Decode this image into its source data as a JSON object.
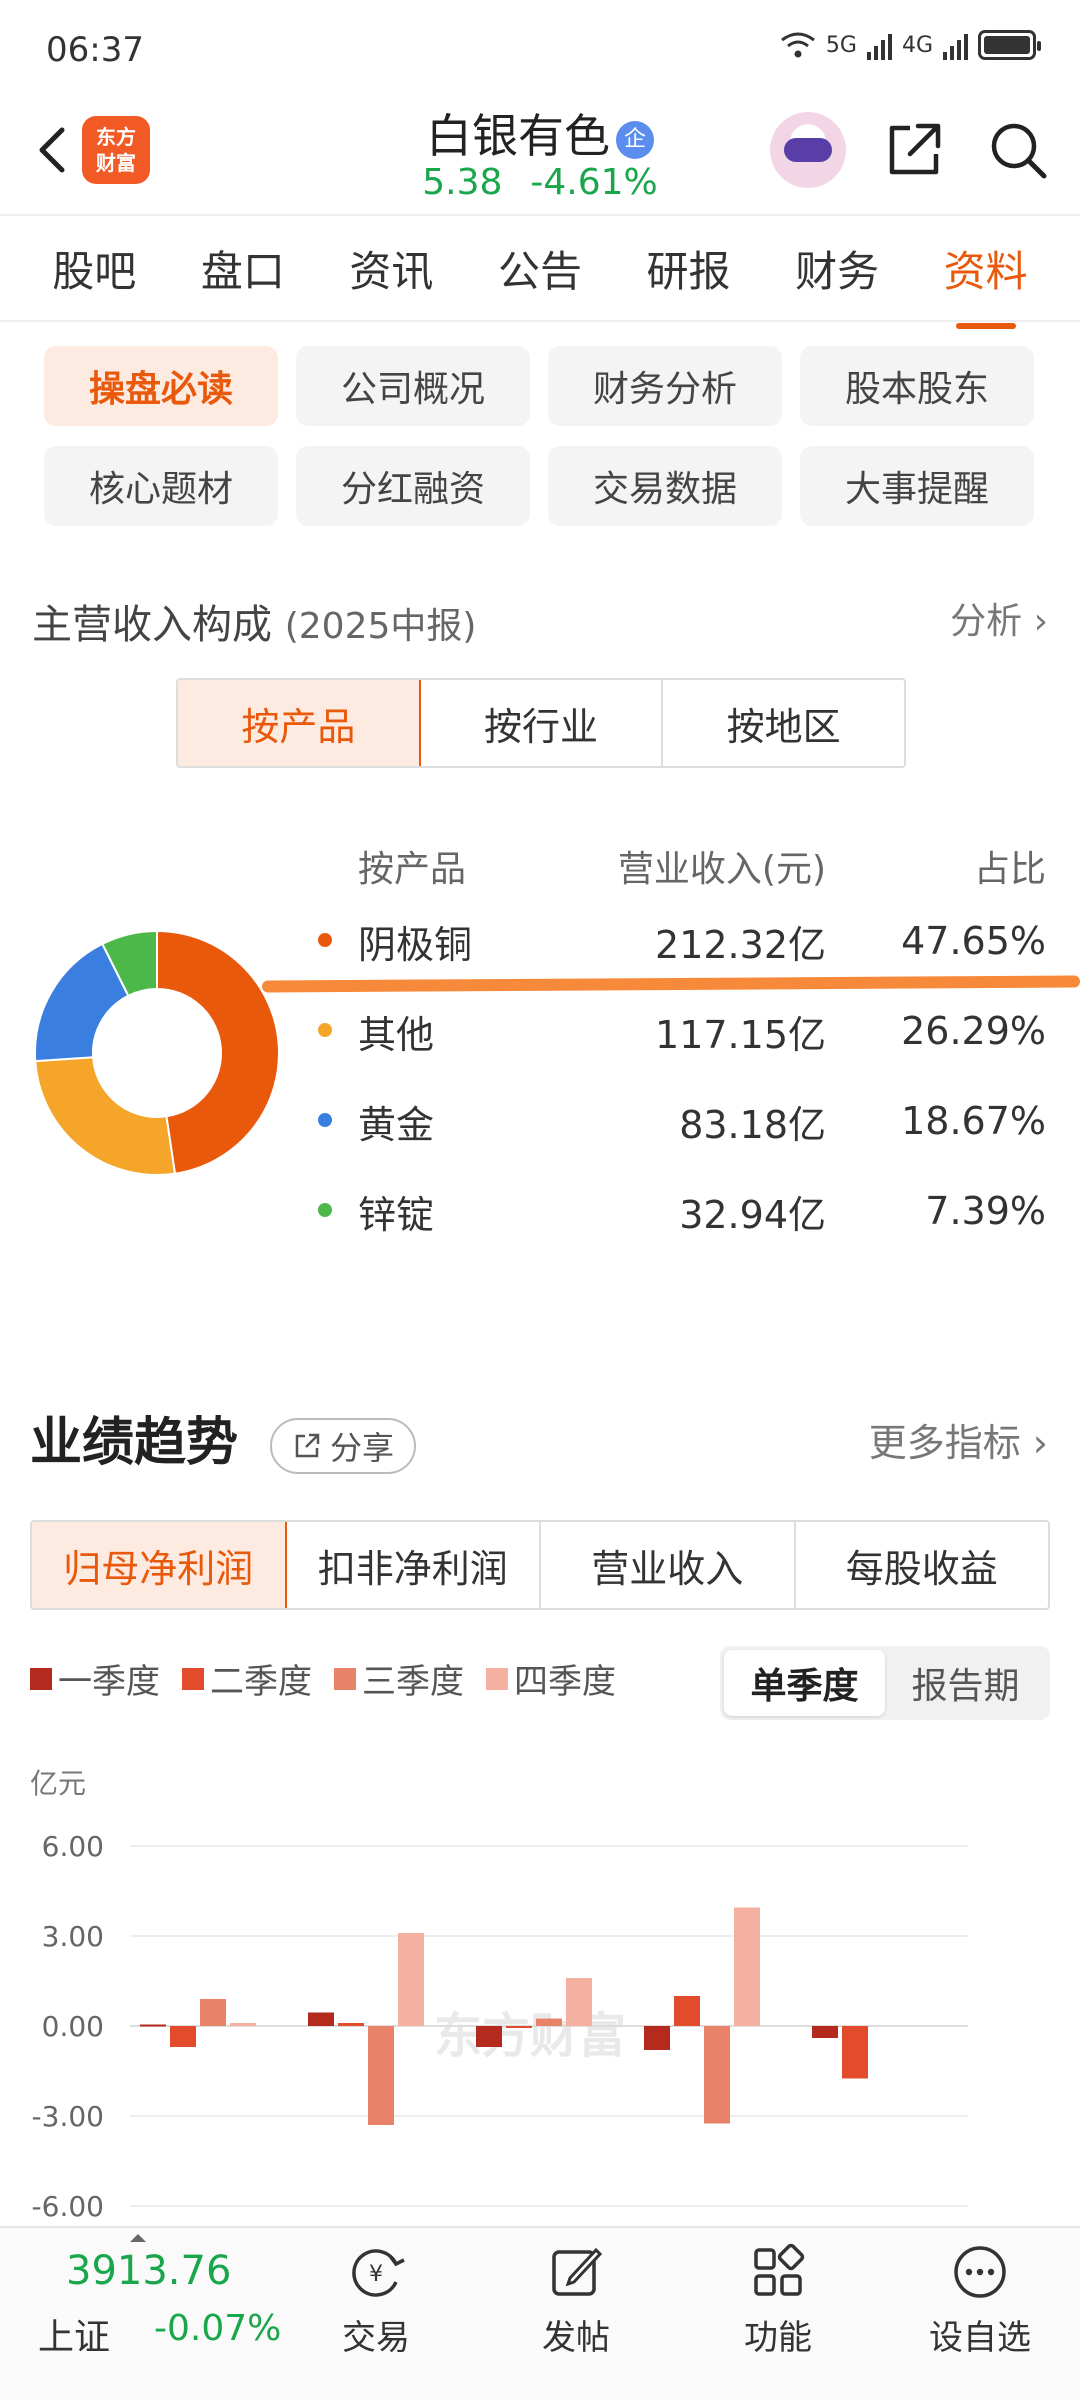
{
  "status_bar": {
    "time": "06:37",
    "net1": "5G",
    "net2": "4G"
  },
  "header": {
    "logo_text_1": "东方",
    "logo_text_2": "财富",
    "stock_name": "白银有色",
    "badge": "企",
    "price": "5.38",
    "change_pct": "-4.61%"
  },
  "main_tabs": [
    {
      "label": "股吧"
    },
    {
      "label": "盘口"
    },
    {
      "label": "资讯"
    },
    {
      "label": "公告"
    },
    {
      "label": "研报"
    },
    {
      "label": "财务"
    },
    {
      "label": "资料",
      "active": true
    }
  ],
  "sub_menu": [
    {
      "label": "操盘必读",
      "active": true
    },
    {
      "label": "公司概况"
    },
    {
      "label": "财务分析"
    },
    {
      "label": "股本股东"
    },
    {
      "label": "核心题材"
    },
    {
      "label": "分红融资"
    },
    {
      "label": "交易数据"
    },
    {
      "label": "大事提醒"
    }
  ],
  "revenue": {
    "title": "主营收入构成",
    "period": "(2025中报)",
    "analysis_link": "分析",
    "segments": [
      {
        "label": "按产品",
        "active": true
      },
      {
        "label": "按行业"
      },
      {
        "label": "按地区"
      }
    ],
    "columns": {
      "name": "按产品",
      "revenue": "营业收入(元)",
      "pct": "占比"
    },
    "rows": [
      {
        "name": "阴极铜",
        "revenue": "212.32亿",
        "pct": "47.65%",
        "share": 47.65,
        "color": "#e8590c"
      },
      {
        "name": "其他",
        "revenue": "117.15亿",
        "pct": "26.29%",
        "share": 26.29,
        "color": "#f5a52a"
      },
      {
        "name": "黄金",
        "revenue": "83.18亿",
        "pct": "18.67%",
        "share": 18.67,
        "color": "#3a7fe0"
      },
      {
        "name": "锌锭",
        "revenue": "32.94亿",
        "pct": "7.39%",
        "share": 7.39,
        "color": "#4cb84a"
      }
    ]
  },
  "performance": {
    "title": "业绩趋势",
    "share_label": "分享",
    "more_link": "更多指标",
    "metric_tabs": [
      {
        "label": "归母净利润",
        "active": true
      },
      {
        "label": "扣非净利润"
      },
      {
        "label": "营业收入"
      },
      {
        "label": "每股收益"
      }
    ],
    "legend": [
      {
        "label": "一季度",
        "color": "#b52a1e"
      },
      {
        "label": "二季度",
        "color": "#e24b2c"
      },
      {
        "label": "三季度",
        "color": "#e8836a"
      },
      {
        "label": "四季度",
        "color": "#f4b1a1"
      }
    ],
    "period_toggle": [
      {
        "label": "单季度",
        "active": true
      },
      {
        "label": "报告期"
      }
    ],
    "unit": "亿元",
    "watermark": "东方财富"
  },
  "chart_data": {
    "type": "bar",
    "ylim": [
      -6,
      6
    ],
    "y_ticks": [
      "6.00",
      "3.00",
      "0.00",
      "-3.00",
      "-6.00"
    ],
    "y_tick_values": [
      6,
      3,
      0,
      -3,
      -6
    ],
    "series": [
      {
        "name": "一季度",
        "values": [
          0.05,
          0.45,
          -0.7,
          -0.8,
          -0.4
        ]
      },
      {
        "name": "二季度",
        "values": [
          -0.7,
          0.1,
          0.0,
          1.0,
          -1.75
        ]
      },
      {
        "name": "三季度",
        "values": [
          0.9,
          -3.3,
          0.25,
          -3.25
        ]
      },
      {
        "name": "四季度",
        "values": [
          0.1,
          3.1,
          1.6,
          3.95
        ]
      }
    ]
  },
  "bottom_bar": {
    "index_value": "3913.76",
    "index_name": "上证",
    "index_change": "-0.07%",
    "nav": [
      {
        "label": "交易"
      },
      {
        "label": "发帖"
      },
      {
        "label": "功能"
      },
      {
        "label": "设自选"
      }
    ]
  }
}
